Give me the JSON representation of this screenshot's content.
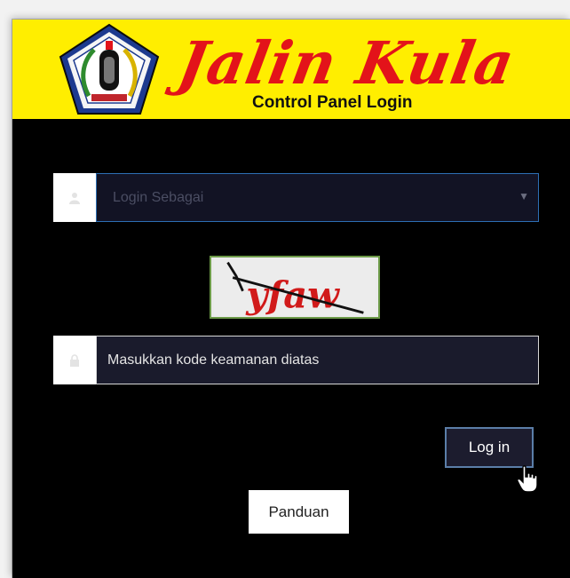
{
  "header": {
    "brand": "Jalin Kula",
    "subtitle": "Control Panel Login"
  },
  "form": {
    "role_select": {
      "placeholder": "Login Sebagai",
      "icon": "user-icon"
    },
    "captcha": {
      "text": "yfaw"
    },
    "security_input": {
      "placeholder": "Masukkan kode keamanan diatas",
      "icon": "lock-icon"
    }
  },
  "buttons": {
    "login": "Log in",
    "guide": "Panduan"
  },
  "colors": {
    "banner": "#ffee00",
    "brand": "#e3131a",
    "background": "#000000",
    "select_border": "#2d6fb4"
  }
}
